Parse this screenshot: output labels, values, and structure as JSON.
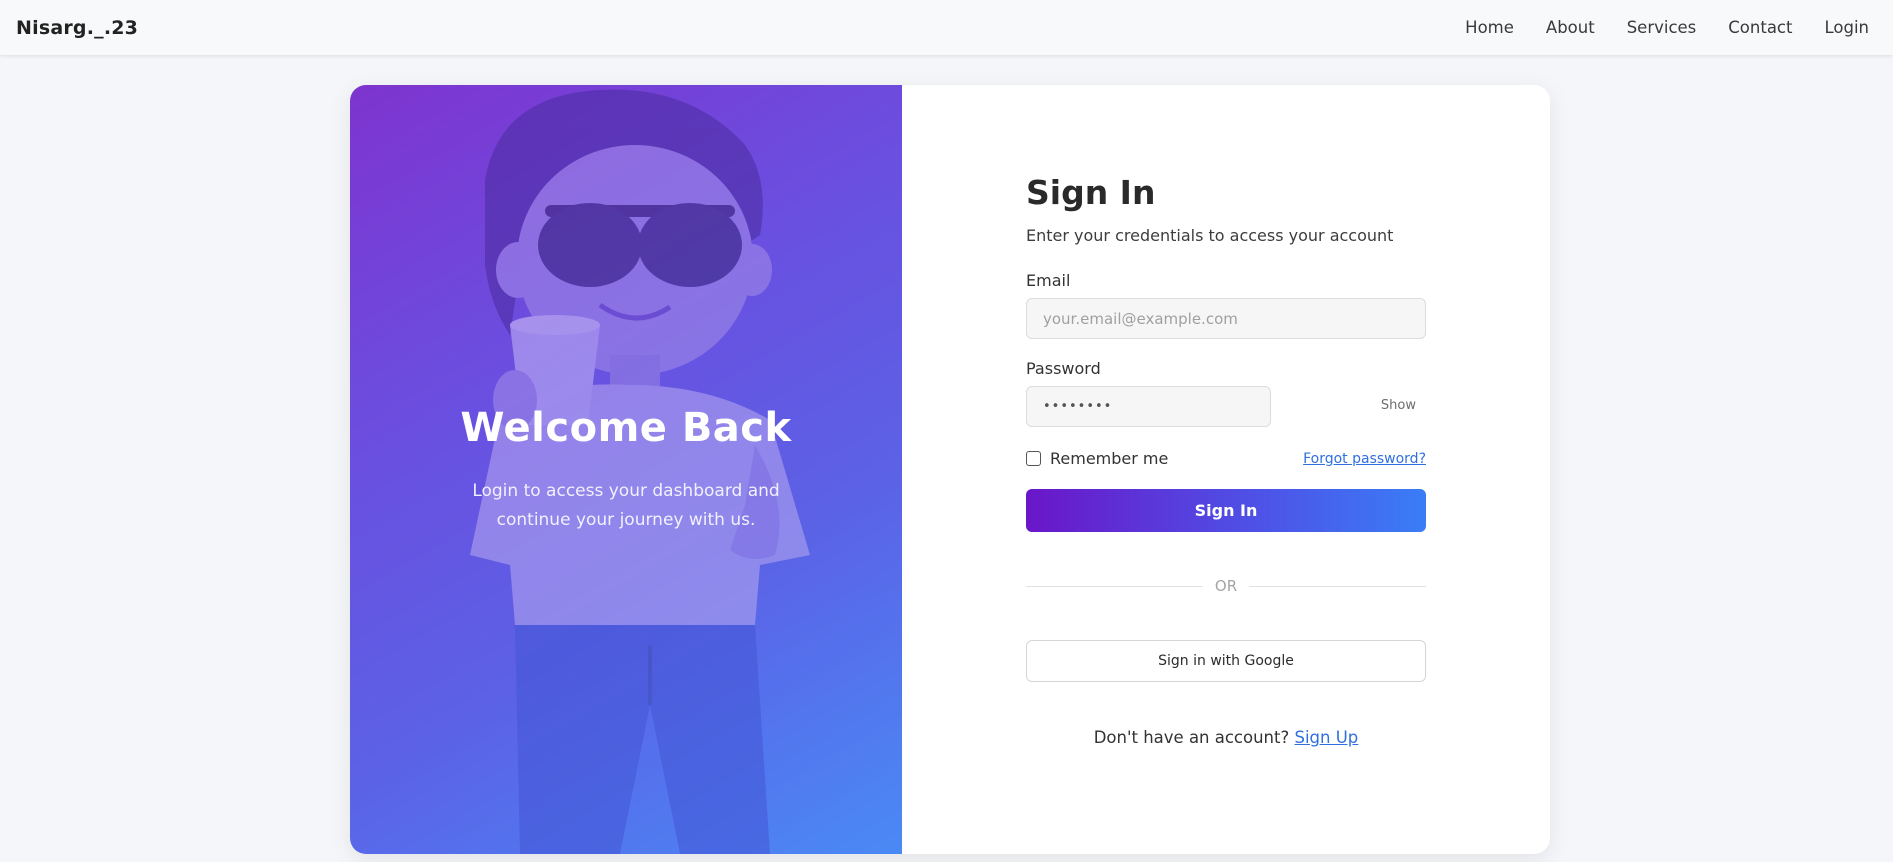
{
  "nav": {
    "brand": "Nisarg._.23",
    "links": [
      "Home",
      "About",
      "Services",
      "Contact",
      "Login"
    ]
  },
  "hero": {
    "title": "Welcome Back",
    "subtitle": "Login to access your dashboard and continue your journey with us.",
    "illustration": "cartoon-boy-with-sunglasses-and-cup"
  },
  "form": {
    "title": "Sign In",
    "subtitle": "Enter your credentials to access your account",
    "email_label": "Email",
    "email_placeholder": "your.email@example.com",
    "password_label": "Password",
    "password_value": "••••••••",
    "show_label": "Show",
    "remember_label": "Remember me",
    "forgot_label": "Forgot password?",
    "signin_label": "Sign In",
    "divider_label": "OR",
    "google_label": "Sign in with Google",
    "signup_prompt": "Don't have an account?",
    "signup_label": "Sign Up"
  },
  "colors": {
    "accent_start": "#6a16c9",
    "accent_end": "#3a7df6",
    "link": "#2f6fe0"
  }
}
